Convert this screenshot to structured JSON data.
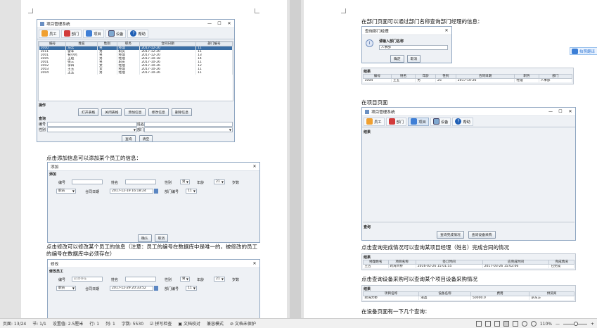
{
  "left_page": {
    "main_window": {
      "title": "项目管理系统",
      "tabs": [
        "员工",
        "部门",
        "项目",
        "设备",
        "帮助"
      ],
      "table_headers": [
        "编号",
        "姓名",
        "性别",
        "职务",
        "合同日期",
        "部门编号"
      ],
      "rows": [
        [
          "1000",
          "马云",
          "男",
          "经理",
          "2017-12-20",
          "11"
        ],
        [
          "1011",
          "雷军",
          "男",
          "职员",
          "2017-12-20",
          "11"
        ],
        [
          "1001",
          "祝小鸡",
          "男",
          "经理",
          "2017-12-20",
          "13"
        ],
        [
          "1005",
          "王超",
          "男",
          "经理",
          "2017-10-18",
          "14"
        ],
        [
          "1001",
          "张三",
          "男",
          "职员",
          "2017-10-26",
          "11"
        ],
        [
          "1002",
          "李四",
          "女",
          "经理",
          "2017-10-26",
          "12"
        ],
        [
          "1003",
          "王五",
          "女",
          "经理",
          "2017-10-26",
          "11"
        ],
        [
          "1004",
          "王五",
          "男",
          "经理",
          "2017-10-26",
          "11"
        ]
      ],
      "ops_title": "操作",
      "ops_buttons": [
        "打开表格",
        "关闭表格",
        "添加信息",
        "修改信息",
        "删除信息"
      ],
      "query_title": "查询",
      "query_labels": [
        "编号",
        "姓名",
        "性别",
        "部门"
      ],
      "query_buttons": [
        "查询",
        "清空"
      ]
    },
    "caption_add": "点击添加信息可以添加某个员工的信息：",
    "add_dialog": {
      "title": "添加",
      "section": "添加",
      "labels": [
        "编号",
        "姓名",
        "性别",
        "年龄",
        "岁数",
        "合同日期",
        "部门编号"
      ],
      "gender_value": "男",
      "age_value": "21",
      "position_value": "职员",
      "date_value": "2017-12-19 16:18:24",
      "dept_value": "11",
      "buttons": [
        "确认",
        "取消"
      ]
    },
    "caption_modify": "点击修改可以修改某个员工的信息（注意：员工的编号在数据库中是唯一的，被修改的员工的编号在数据库中必须存在）",
    "modify_dialog": {
      "title": "修改",
      "section": "修改员工",
      "labels": [
        "编号",
        "姓名",
        "性别",
        "年龄",
        "岁数",
        "合同日期",
        "部门编号"
      ],
      "id_placeholder": "必须存在",
      "gender_value": "男",
      "age_value": "21",
      "position_value": "职员",
      "date_value": "2017-12-29 20:33:52",
      "dept_value": "11"
    }
  },
  "right_page": {
    "caption_dept": "在部门页面可以通过部门名称查询部门经理的信息：",
    "dept_dialog": {
      "title": "查询部门经理",
      "prompt": "请输入部门名称",
      "value": "人事部",
      "buttons": [
        "确定",
        "取消"
      ]
    },
    "result1": {
      "title": "结果",
      "headers": [
        "编号",
        "姓名",
        "年龄",
        "性别",
        "合同日期",
        "职务",
        "部门"
      ],
      "row": [
        "1004",
        "王五",
        "男",
        "25",
        "2017-10-26",
        "经理",
        "人事部"
      ]
    },
    "caption_project": "在项目页面",
    "project_window": {
      "title": "项目管理系统",
      "tabs": [
        "员工",
        "部门",
        "项目",
        "设备",
        "帮助"
      ],
      "result_title": "结果",
      "query_title": "查询",
      "buttons": [
        "查询完成情况",
        "查询设备采购"
      ]
    },
    "caption_completion": "点击查询完成情况可以查询某项目经理（姓名）完成合同的情况",
    "result2": {
      "title": "结果",
      "headers": [
        "经理姓名",
        "项目名称",
        "签订时间",
        "应完成时间",
        "完成情况"
      ],
      "row": [
        "王五",
        "跨海大桥",
        "2016-02-26 15:01:55",
        "2017-03-26 15:02:06",
        "已完成"
      ]
    },
    "caption_equipment": "点击查询设备采购可以查询某个项目设备采购情况",
    "result3": {
      "title": "结果",
      "headers": [
        "项目名称",
        "设备名称",
        "费用",
        "供货商"
      ],
      "row": [
        "跨海大桥",
        "液晶",
        "50000.0",
        "京东方"
      ]
    },
    "caption_equipment_page": "在设备页面有一下几个查询："
  },
  "float_button": "拍照翻译",
  "status_bar": {
    "items": [
      "页面: 13/24",
      "节: 1/1",
      "设置值: 2.5厘米",
      "行: 1",
      "列: 1",
      "字数: 5530",
      "拼写检查",
      "文档校对",
      "兼容模式",
      "文档未保护"
    ],
    "zoom": "110%"
  }
}
